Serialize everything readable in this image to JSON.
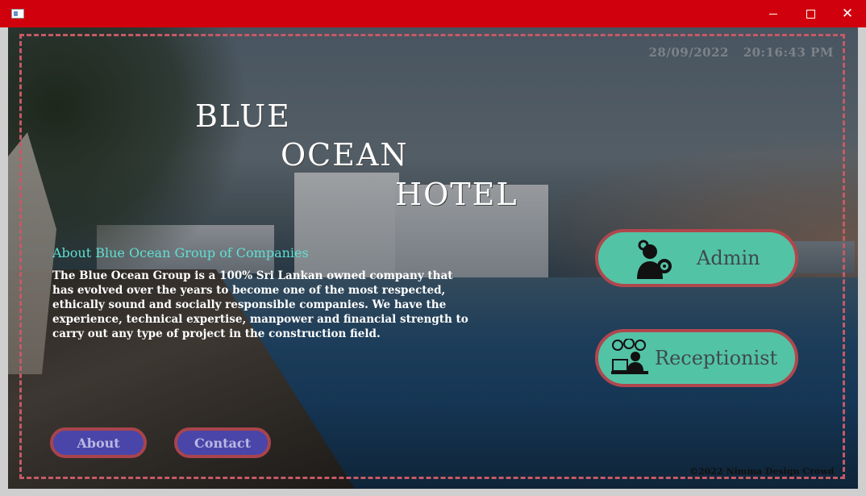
{
  "window": {
    "controls": {
      "minimize": "—",
      "maximize": "☐",
      "close": "✕"
    }
  },
  "header": {
    "date": "28/09/2022",
    "time": "20:16:43 PM"
  },
  "hotel_title": {
    "line1": "BLUE",
    "line2": "OCEAN",
    "line3": "HOTEL"
  },
  "about": {
    "heading": "About Blue Ocean Group of Companies",
    "text": "The Blue Ocean Group is a 100% Sri Lankan owned company that has evolved over the years to become one of the most respected, ethically sound and socially responsible companies. We have the experience, technical expertise, manpower and financial strength to carry out any type of project in the construction field."
  },
  "roles": {
    "admin_label": "Admin",
    "admin_icon": "admin-gear-user-icon",
    "receptionist_label": "Receptionist",
    "receptionist_icon": "receptionist-desk-icon"
  },
  "nav": {
    "about_label": "About",
    "contact_label": "Contact"
  },
  "footer": {
    "copyright": "©2022 Nimma Design Crowd"
  },
  "colors": {
    "titlebar": "#d0000d",
    "role_button": "#53c3a6",
    "role_border": "#b0474d",
    "nav_button": "#4a45a8",
    "about_heading": "#5fe0d2"
  }
}
